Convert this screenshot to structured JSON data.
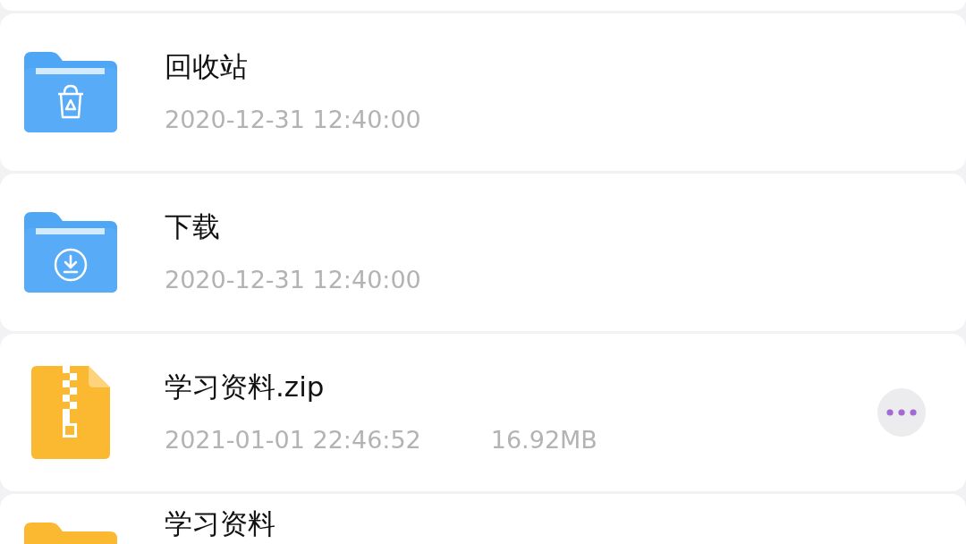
{
  "files": [
    {
      "kind": "recycle-folder",
      "name": "回收站",
      "date": "2020-12-31 12:40:00",
      "more_button": false
    },
    {
      "kind": "download-folder",
      "name": "下载",
      "date": "2020-12-31 12:40:00",
      "more_button": false
    },
    {
      "kind": "zip",
      "name": "学习资料.zip",
      "date": "2021-01-01 22:46:52",
      "size": "16.92MB",
      "more_button": true
    },
    {
      "kind": "plain-folder",
      "name": "学习资料",
      "more_button": false
    }
  ]
}
